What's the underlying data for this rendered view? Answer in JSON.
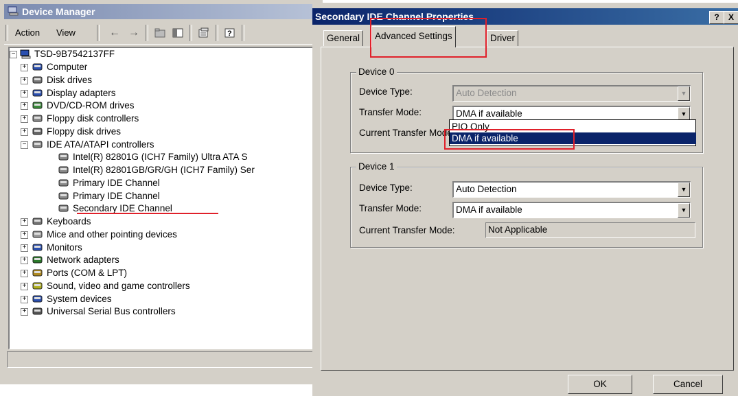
{
  "device_manager": {
    "title": "Device Manager",
    "menu": {
      "action": "Action",
      "view": "View"
    },
    "tree": {
      "root": "TSD-9B7542137FF",
      "items": [
        {
          "label": "Computer",
          "icon": "computer-icon"
        },
        {
          "label": "Disk drives",
          "icon": "disk-drive-icon"
        },
        {
          "label": "Display adapters",
          "icon": "display-adapter-icon"
        },
        {
          "label": "DVD/CD-ROM drives",
          "icon": "cdrom-icon"
        },
        {
          "label": "Floppy disk controllers",
          "icon": "controller-icon"
        },
        {
          "label": "Floppy disk drives",
          "icon": "floppy-icon"
        },
        {
          "label": "IDE ATA/ATAPI controllers",
          "icon": "controller-icon"
        },
        {
          "label": "Keyboards",
          "icon": "keyboard-icon"
        },
        {
          "label": "Mice and other pointing devices",
          "icon": "mouse-icon"
        },
        {
          "label": "Monitors",
          "icon": "monitor-icon"
        },
        {
          "label": "Network adapters",
          "icon": "network-adapter-icon"
        },
        {
          "label": "Ports (COM & LPT)",
          "icon": "port-icon"
        },
        {
          "label": "Sound, video and game controllers",
          "icon": "sound-icon"
        },
        {
          "label": "System devices",
          "icon": "system-device-icon"
        },
        {
          "label": "Universal Serial Bus controllers",
          "icon": "usb-icon"
        }
      ],
      "ide_children": [
        "Intel(R) 82801G (ICH7 Family) Ultra ATA S",
        "Intel(R) 82801GB/GR/GH (ICH7 Family) Ser",
        "Primary IDE Channel",
        "Primary IDE Channel",
        "Secondary IDE Channel"
      ]
    }
  },
  "dialog": {
    "title": "Secondary IDE Channel Properties",
    "help_button": "?",
    "close_button": "X",
    "tabs": [
      "General",
      "Advanced Settings",
      "Driver"
    ],
    "device0": {
      "legend": "Device 0",
      "device_type_label": "Device Type:",
      "device_type_value": "Auto Detection",
      "transfer_mode_label": "Transfer Mode:",
      "transfer_mode_value": "DMA if available",
      "current_transfer_label": "Current Transfer Mode:",
      "dropdown_options": [
        "PIO Only",
        "DMA if available"
      ]
    },
    "device1": {
      "legend": "Device 1",
      "device_type_label": "Device Type:",
      "device_type_value": "Auto Detection",
      "transfer_mode_label": "Transfer Mode:",
      "transfer_mode_value": "DMA if available",
      "current_transfer_label": "Current Transfer Mode:",
      "current_transfer_value": "Not Applicable"
    },
    "ok_label": "OK",
    "cancel_label": "Cancel"
  },
  "colors": {
    "highlight": "#e0202a",
    "titlebar_active": "#0a246a",
    "titlebar_inactive": "#7b8bb0",
    "face": "#d4d0c8"
  }
}
